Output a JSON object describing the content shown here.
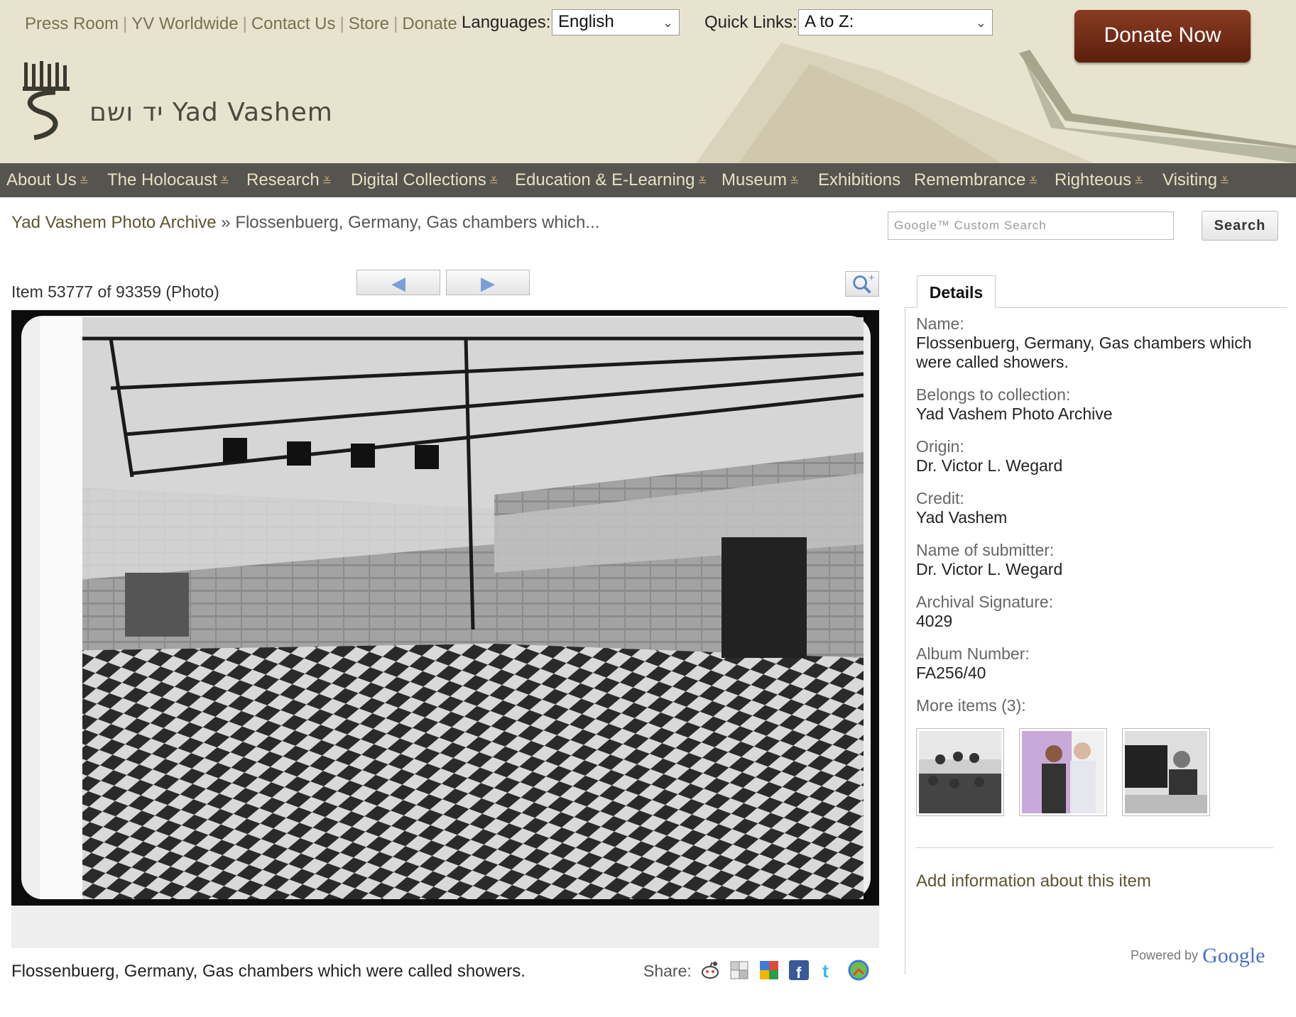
{
  "header": {
    "top_links": [
      "Press Room",
      "YV Worldwide",
      "Contact Us",
      "Store",
      "Donate"
    ],
    "languages_label": "Languages:",
    "language_value": "English",
    "quick_links_label": "Quick Links:",
    "quick_links_value": "A to Z:",
    "donate_button": "Donate Now",
    "logo_text": "יד ושם  Yad Vashem"
  },
  "nav": {
    "items": [
      {
        "label": "About Us",
        "chevron": true
      },
      {
        "label": "The Holocaust",
        "chevron": true
      },
      {
        "label": "Research",
        "chevron": true
      },
      {
        "label": "Digital Collections",
        "chevron": true
      },
      {
        "label": "Education & E-Learning",
        "chevron": true
      },
      {
        "label": "Museum",
        "chevron": true
      },
      {
        "label": "Exhibitions",
        "chevron": false
      },
      {
        "label": "Remembrance",
        "chevron": true
      },
      {
        "label": "Righteous",
        "chevron": true
      },
      {
        "label": "Visiting",
        "chevron": true
      }
    ]
  },
  "breadcrumb": {
    "root": "Yad Vashem Photo Archive",
    "separator": "»",
    "current": "Flossenbuerg, Germany, Gas chambers which..."
  },
  "search": {
    "placeholder": "Google™ Custom Search",
    "button": "Search"
  },
  "item": {
    "count_text": "Item 53777 of 93359 (Photo)",
    "prev_icon": "◀",
    "next_icon": "▶",
    "caption": "Flossenbuerg, Germany, Gas chambers which were called showers.",
    "share_label": "Share:"
  },
  "details": {
    "tab": "Details",
    "fields": [
      {
        "label": "Name:",
        "value": "Flossenbuerg, Germany, Gas chambers which were called showers."
      },
      {
        "label": "Belongs to collection:",
        "value": "Yad Vashem Photo Archive"
      },
      {
        "label": "Origin:",
        "value": "Dr. Victor L. Wegard"
      },
      {
        "label": "Credit:",
        "value": "Yad Vashem"
      },
      {
        "label": "Name of submitter:",
        "value": "Dr. Victor L. Wegard"
      },
      {
        "label": "Archival Signature:",
        "value": "4029"
      },
      {
        "label": "Album Number:",
        "value": "FA256/40"
      }
    ],
    "more_items_label": "More items (3):",
    "add_info": "Add information about this item",
    "powered_by": "Powered by",
    "powered_brand": "Google"
  },
  "colors": {
    "header_bg": "#e8e3cf",
    "nav_bg": "#56544f",
    "nav_text": "#e8e0c2",
    "donate": "#7a2f18",
    "link": "#5a5530"
  }
}
